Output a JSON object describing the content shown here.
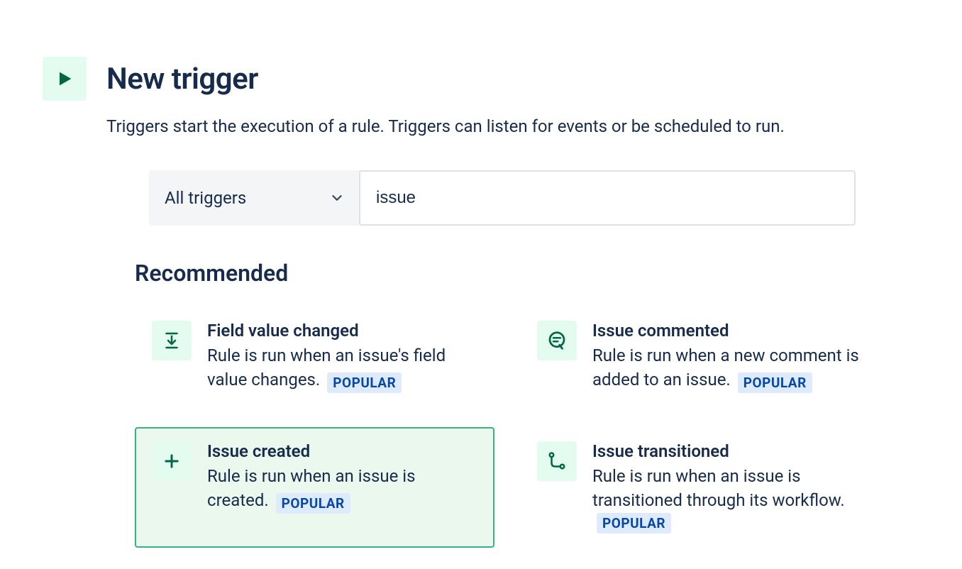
{
  "header": {
    "title": "New trigger",
    "subtitle": "Triggers start the execution of a rule. Triggers can listen for events or be scheduled to run."
  },
  "filter": {
    "dropdown_label": "All triggers",
    "search_value": "issue"
  },
  "section": {
    "heading": "Recommended"
  },
  "badge_label": "POPULAR",
  "cards": [
    {
      "title": "Field value changed",
      "desc": "Rule is run when an issue's field value changes.",
      "popular": true
    },
    {
      "title": "Issue commented",
      "desc": "Rule is run when a new comment is added to an issue.",
      "popular": true
    },
    {
      "title": "Issue created",
      "desc": "Rule is run when an issue is created.",
      "popular": true
    },
    {
      "title": "Issue transitioned",
      "desc": "Rule is run when an issue is transitioned through its workflow.",
      "popular": true
    }
  ]
}
